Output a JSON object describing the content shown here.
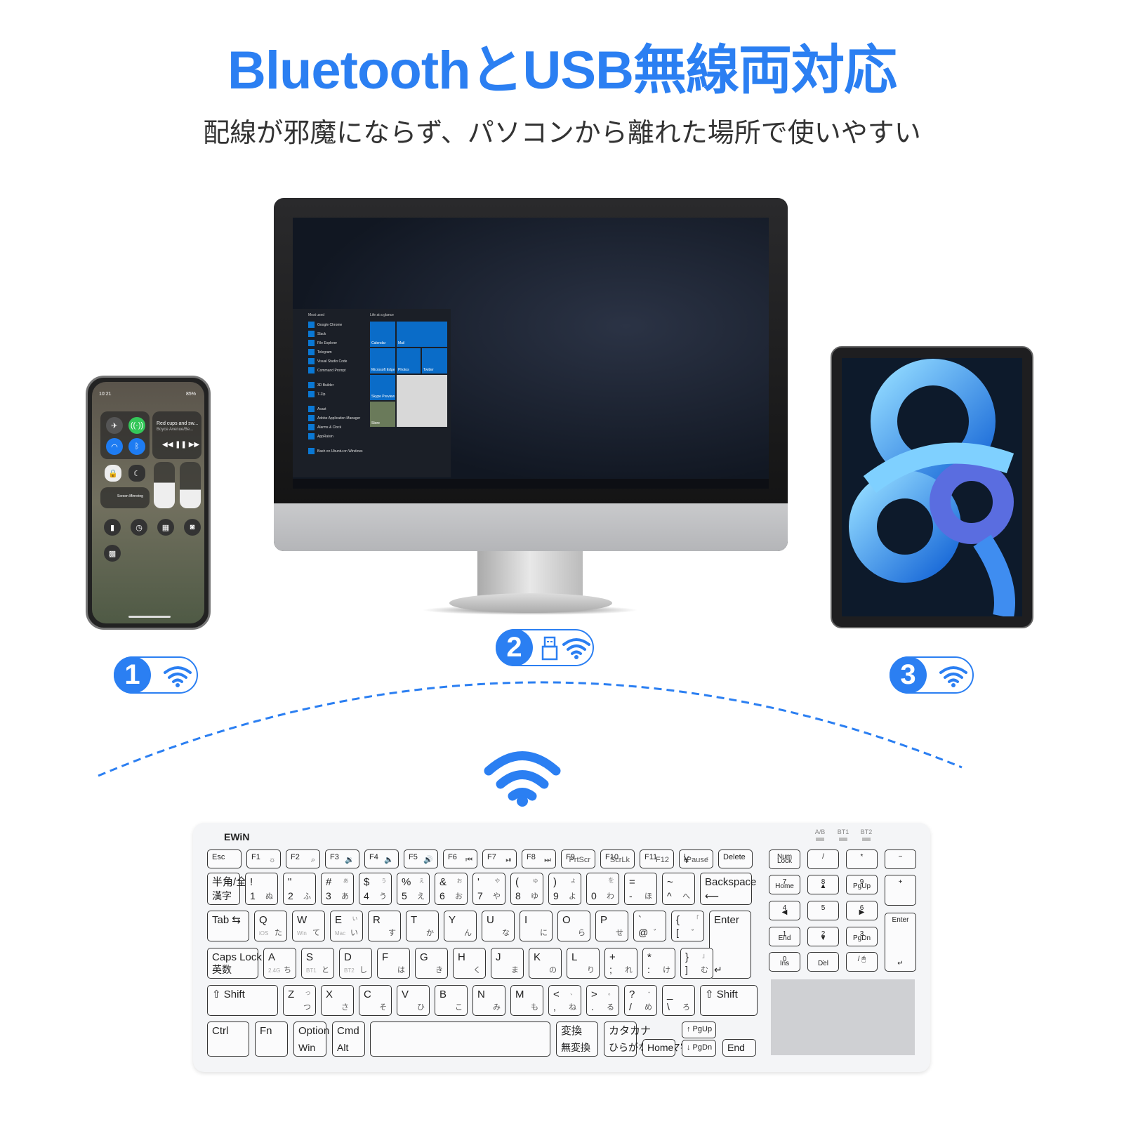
{
  "headline": {
    "title": "BluetoothとUSB無線両対応",
    "subtitle": "配線が邪魔にならず、パソコンから離れた場所で使いやすい"
  },
  "colors": {
    "accent": "#2b7ff2",
    "text": "#333333",
    "keyboard": "#f4f5f7"
  },
  "devices": {
    "phone": {
      "time": "10:21",
      "battery": "85%",
      "music_title": "Red cups and sw...",
      "music_artist": "Boyce Avenue/Be...",
      "screen_mirroring": "Screen Mirroring"
    },
    "monitor": {
      "start_menu": {
        "most_used_label": "Most used",
        "apps": [
          "Google Chrome",
          "Slack",
          "File Explorer",
          "Telegram",
          "Visual Studio Code",
          "Command Prompt",
          "3D Builder",
          "7-Zip",
          "Acast",
          "Adobe Application Manager",
          "Alarms & Clock",
          "AppRaisin",
          "Bash on Ubuntu on Windows"
        ],
        "tiles_label": "Life at a glance",
        "tiles": [
          "Calendar",
          "Mail",
          "Microsoft Edge",
          "Photos",
          "Twitter",
          "Skype Preview",
          "Store"
        ]
      }
    },
    "ipad": {}
  },
  "badges": [
    {
      "number": "1",
      "icons": [
        "wifi-icon"
      ]
    },
    {
      "number": "2",
      "icons": [
        "usb-icon",
        "wifi-icon"
      ]
    },
    {
      "number": "3",
      "icons": [
        "wifi-icon"
      ]
    }
  ],
  "keyboard": {
    "brand": "EWiN",
    "leds": [
      "A/B",
      "BT1",
      "BT2"
    ],
    "rows": [
      [
        {
          "tl": "Esc"
        },
        {
          "tl": "F1",
          "br": "☼"
        },
        {
          "tl": "F2",
          "br": "⌕"
        },
        {
          "tl": "F3",
          "br": "🔉"
        },
        {
          "tl": "F4",
          "br": "🔈"
        },
        {
          "tl": "F5",
          "br": "🔊"
        },
        {
          "tl": "F6",
          "br": "⏮"
        },
        {
          "tl": "F7",
          "br": "⏯"
        },
        {
          "tl": "F8",
          "br": "⏭"
        },
        {
          "tl": "F9",
          "br": "PrtScr"
        },
        {
          "tl": "F10",
          "br": "ScrLk"
        },
        {
          "tl": "F11",
          "br": "F12"
        },
        {
          "tl": "|",
          "bl": "¥",
          "tr": "-",
          "br": "Pause"
        },
        {
          "tl": "Delete"
        }
      ],
      [
        {
          "tl": "半角/全角",
          "bl": "漢字"
        },
        {
          "tl": "!",
          "bl": "1",
          "br": "ぬ"
        },
        {
          "tl": "\"",
          "bl": "2",
          "br": "ふ"
        },
        {
          "tl": "#",
          "bl": "3",
          "tr": "ぁ",
          "br": "あ"
        },
        {
          "tl": "$",
          "bl": "4",
          "tr": "ぅ",
          "br": "う"
        },
        {
          "tl": "%",
          "bl": "5",
          "tr": "ぇ",
          "br": "え"
        },
        {
          "tl": "&",
          "bl": "6",
          "tr": "ぉ",
          "br": "お"
        },
        {
          "tl": "'",
          "bl": "7",
          "tr": "ゃ",
          "br": "や"
        },
        {
          "tl": "(",
          "bl": "8",
          "tr": "ゅ",
          "br": "ゆ"
        },
        {
          "tl": ")",
          "bl": "9",
          "tr": "ょ",
          "br": "よ"
        },
        {
          "tl": "",
          "bl": "0",
          "tr": "を",
          "br": "わ"
        },
        {
          "tl": "=",
          "bl": "-",
          "br": "ほ"
        },
        {
          "tl": "~",
          "bl": "^",
          "br": "へ"
        },
        {
          "tl": "Backspace",
          "bl": "⟵"
        }
      ],
      [
        {
          "tl": "Tab ⇆"
        },
        {
          "tl": "Q",
          "gs": "iOS",
          "br": "た"
        },
        {
          "tl": "W",
          "gs": "Win",
          "br": "て"
        },
        {
          "tl": "E",
          "gs": "Mac",
          "tr": "ぃ",
          "br": "い"
        },
        {
          "tl": "R",
          "br": "す"
        },
        {
          "tl": "T",
          "br": "か"
        },
        {
          "tl": "Y",
          "br": "ん"
        },
        {
          "tl": "U",
          "br": "な"
        },
        {
          "tl": "I",
          "br": "に"
        },
        {
          "tl": "O",
          "br": "ら"
        },
        {
          "tl": "P",
          "br": "せ"
        },
        {
          "tl": "`",
          "bl": "@",
          "br": "゛"
        },
        {
          "tl": "{",
          "bl": "[",
          "tr": "「",
          "br": "゜"
        },
        {
          "tl": "Enter",
          "bl": "↵"
        }
      ],
      [
        {
          "tl": "Caps Lock",
          "bl": "英数"
        },
        {
          "tl": "A",
          "gs": "2.4G",
          "br": "ち"
        },
        {
          "tl": "S",
          "gs": "BT1",
          "br": "と"
        },
        {
          "tl": "D",
          "gs": "BT2",
          "br": "し"
        },
        {
          "tl": "F",
          "br": "は"
        },
        {
          "tl": "G",
          "br": "き"
        },
        {
          "tl": "H",
          "br": "く"
        },
        {
          "tl": "J",
          "br": "ま"
        },
        {
          "tl": "K",
          "br": "の"
        },
        {
          "tl": "L",
          "br": "り"
        },
        {
          "tl": "+",
          "bl": ";",
          "br": "れ"
        },
        {
          "tl": "*",
          "bl": ":",
          "br": "け"
        },
        {
          "tl": "}",
          "bl": "]",
          "tr": "」",
          "br": "む"
        }
      ],
      [
        {
          "tl": "⇧ Shift"
        },
        {
          "tl": "Z",
          "tr": "っ",
          "br": "つ"
        },
        {
          "tl": "X",
          "br": "さ"
        },
        {
          "tl": "C",
          "br": "そ"
        },
        {
          "tl": "V",
          "br": "ひ"
        },
        {
          "tl": "B",
          "br": "こ"
        },
        {
          "tl": "N",
          "br": "み"
        },
        {
          "tl": "M",
          "br": "も"
        },
        {
          "tl": "<",
          "bl": ",",
          "tr": "、",
          "br": "ね"
        },
        {
          "tl": ">",
          "bl": ".",
          "tr": "。",
          "br": "る"
        },
        {
          "tl": "?",
          "bl": "/",
          "tr": "・",
          "br": "め"
        },
        {
          "tl": "_",
          "bl": "\\",
          "br": "ろ"
        },
        {
          "tl": "⇧ Shift"
        }
      ],
      [
        {
          "tl": "Ctrl"
        },
        {
          "tl": "Fn"
        },
        {
          "tl": "Option",
          "bl": "Win"
        },
        {
          "tl": "Cmd",
          "bl": "Alt"
        },
        {
          "tl": ""
        },
        {
          "tl": "変換",
          "bl": "無変換"
        },
        {
          "tl": "カタカナ",
          "bl": "ひらがな ローマ字"
        },
        {
          "tl": "←",
          "bl": "Home"
        },
        {
          "tl": "↑ PgUp"
        },
        {
          "tl": "↓ PgDn"
        },
        {
          "tl": "→",
          "bl": "End"
        }
      ]
    ],
    "numpad": [
      {
        "tl": "Num",
        "bl": "Lock"
      },
      {
        "tl": "/"
      },
      {
        "tl": "*"
      },
      {
        "tl": "−"
      },
      {
        "tl": "7",
        "bl": "Home"
      },
      {
        "tl": "8",
        "bl": "▲"
      },
      {
        "tl": "9",
        "bl": "PgUp"
      },
      {
        "tl": "+"
      },
      {
        "tl": "4",
        "bl": "◀"
      },
      {
        "tl": "5"
      },
      {
        "tl": "6",
        "bl": "▶"
      },
      {
        "tl": "Enter",
        "bl": "↵"
      },
      {
        "tl": "1",
        "bl": "End"
      },
      {
        "tl": "2",
        "bl": "▼"
      },
      {
        "tl": "3",
        "bl": "PgDn"
      },
      {
        "tl": "0",
        "bl": "Ins"
      },
      {
        "tl": ".",
        "bl": "Del"
      },
      {
        "tl": "/ 🖱"
      }
    ]
  }
}
